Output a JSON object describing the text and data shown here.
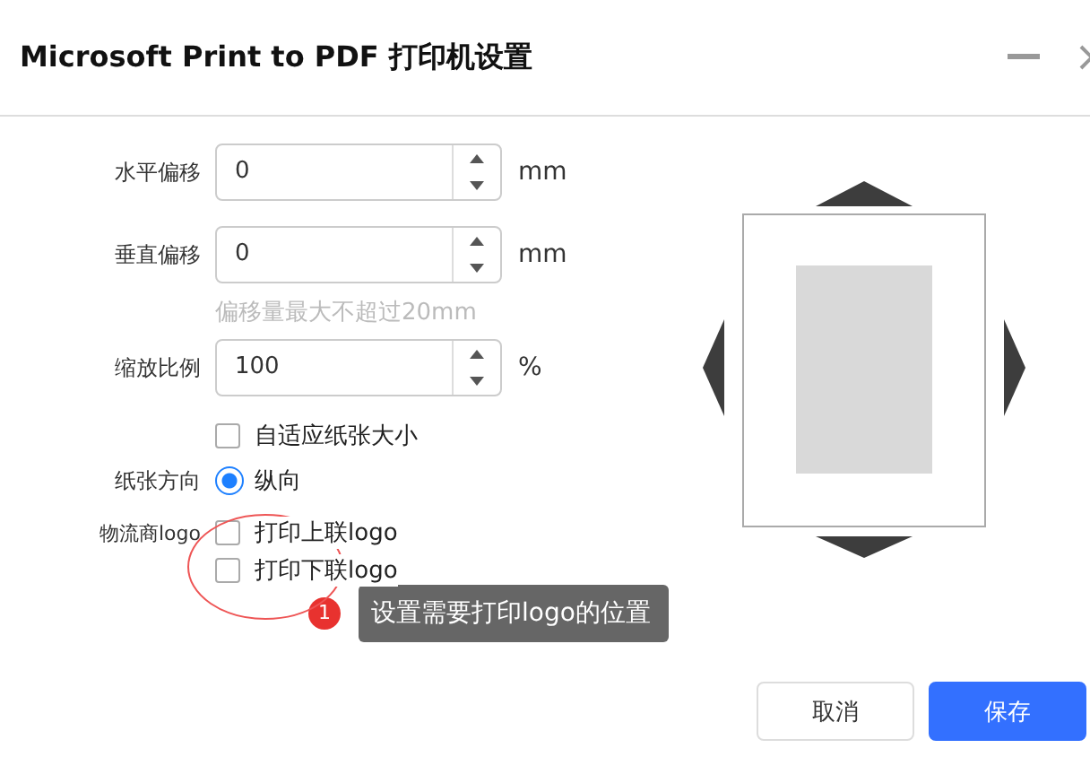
{
  "window": {
    "title": "Microsoft Print to PDF 打印机设置"
  },
  "fields": [
    {
      "kind": "number",
      "label": "水平偏移",
      "value": "0",
      "unit": "mm"
    },
    {
      "kind": "number",
      "label": "垂直偏移",
      "value": "0",
      "unit": "mm"
    },
    {
      "kind": "hint",
      "text": "偏移量最大不超过20mm"
    },
    {
      "kind": "number",
      "label": "缩放比例",
      "value": "100",
      "unit": "%"
    },
    {
      "kind": "checkbox",
      "text": "自适应纸张大小",
      "checked": false
    },
    {
      "kind": "radio",
      "label": "纸张方向",
      "options": [
        {
          "text": "纵向",
          "selected": true
        }
      ]
    },
    {
      "kind": "checkboxes",
      "label": "物流商logo",
      "options": [
        {
          "text": "打印上联logo",
          "checked": false
        },
        {
          "text": "打印下联logo",
          "checked": false
        }
      ]
    }
  ],
  "callout": {
    "badge": "1",
    "text": "设置需要打印logo的位置"
  },
  "buttons": [
    {
      "label": "取消",
      "kind": "secondary"
    },
    {
      "label": "保存",
      "kind": "primary"
    }
  ]
}
